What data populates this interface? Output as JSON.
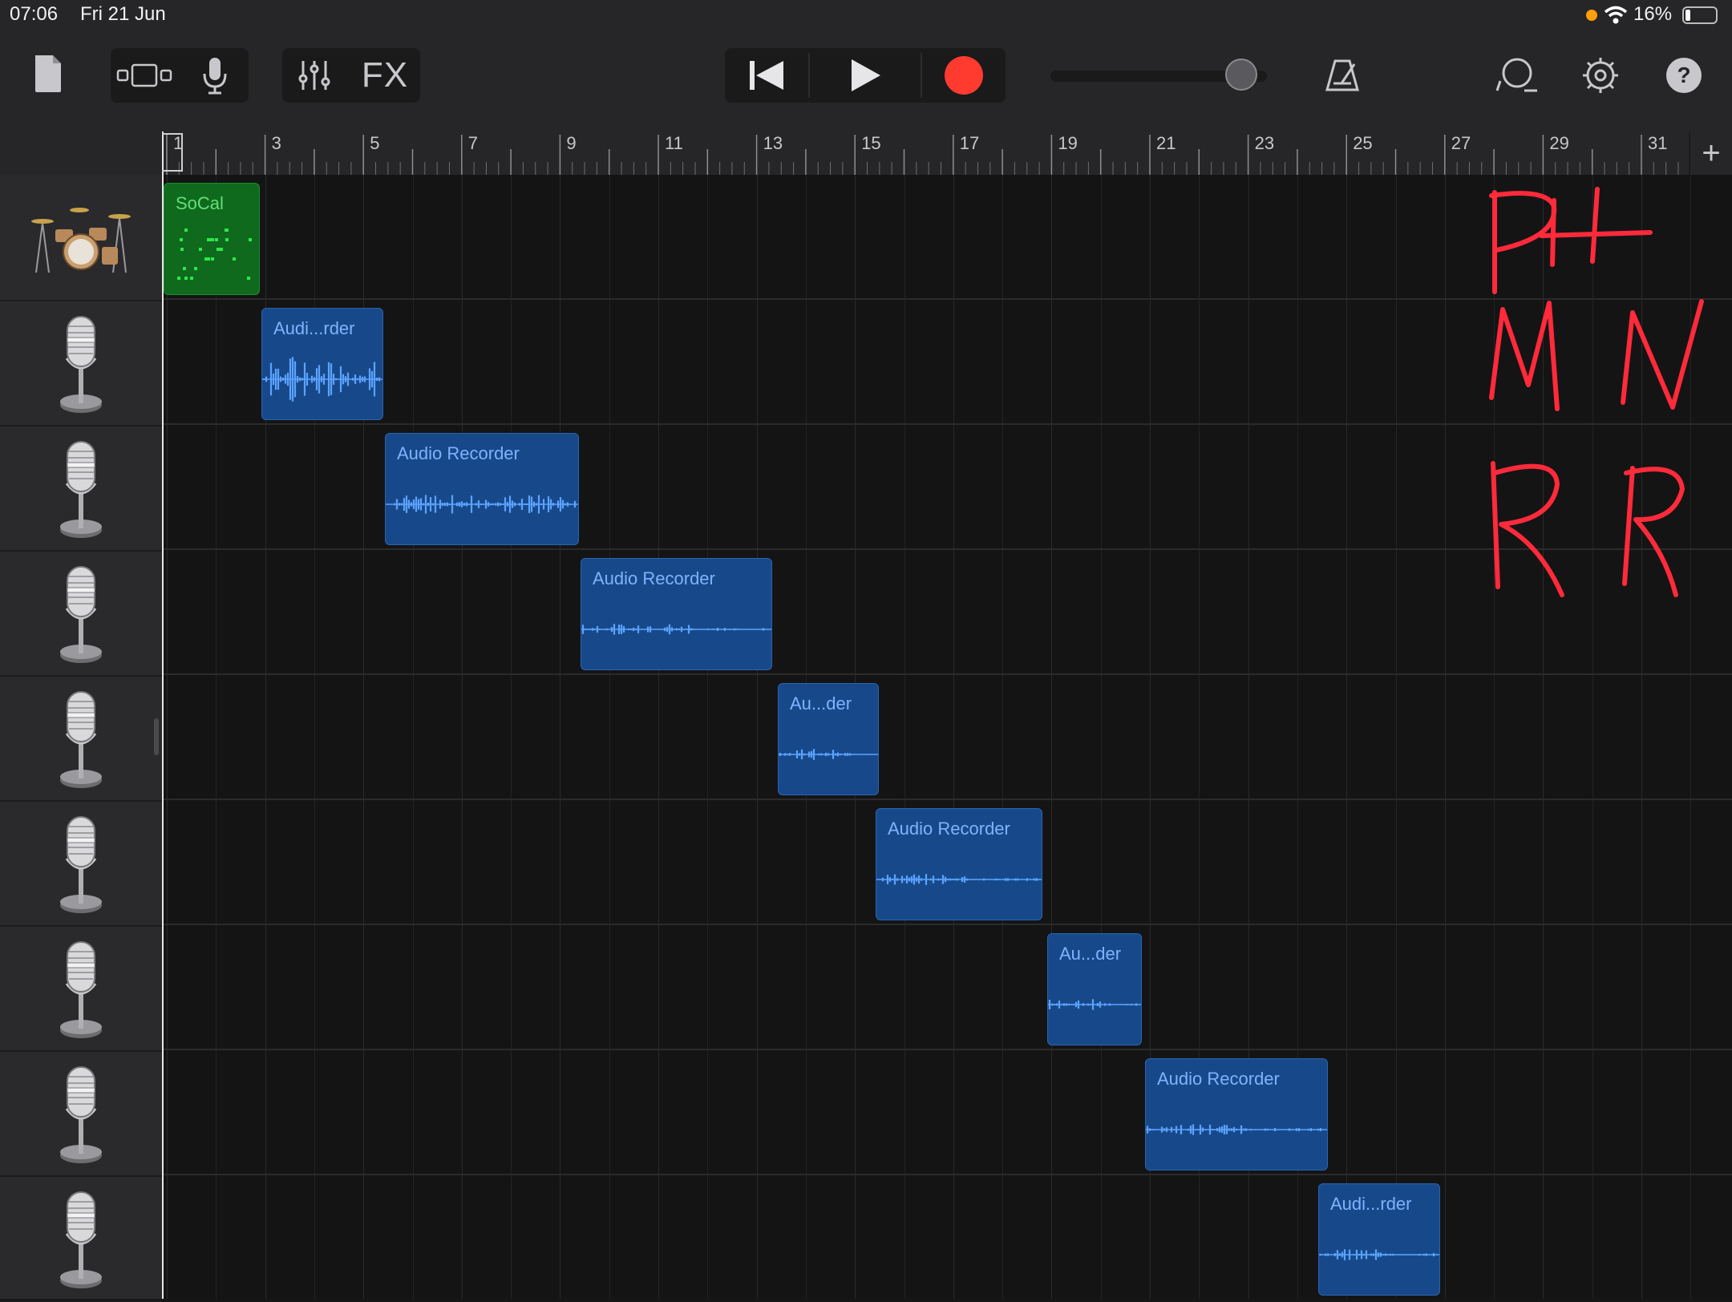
{
  "status_bar": {
    "time": "07:06",
    "date": "Fri 21 Jun",
    "battery": "16%",
    "icons": [
      "orange-dot-icon",
      "wifi-icon",
      "battery-icon"
    ]
  },
  "toolbar": {
    "left_icons": [
      "document-icon",
      "tracks-view-icon",
      "microphone-icon",
      "mixer-icon"
    ],
    "fx_label": "FX",
    "transport": [
      "go-to-start-icon",
      "play-icon",
      "record-icon"
    ],
    "volume_level": 0.88,
    "right_icons": [
      "metronome-icon",
      "loop-icon",
      "settings-icon",
      "help-icon"
    ]
  },
  "ruler": {
    "bar_numbers": [
      "1",
      "3",
      "5",
      "7",
      "9",
      "11",
      "13",
      "15",
      "17",
      "19",
      "21",
      "23",
      "25",
      "27",
      "29",
      "31"
    ],
    "add_label": "+"
  },
  "tracks": [
    {
      "instrument": "drum-kit-icon",
      "regions": [
        {
          "label": "SoCal",
          "type": "drummer"
        }
      ]
    },
    {
      "instrument": "microphone-icon",
      "regions": [
        {
          "label": "Audi...rder",
          "type": "audio"
        }
      ]
    },
    {
      "instrument": "microphone-icon",
      "regions": [
        {
          "label": "Audio Recorder",
          "type": "audio"
        }
      ]
    },
    {
      "instrument": "microphone-icon",
      "regions": [
        {
          "label": "Audio Recorder",
          "type": "audio"
        }
      ]
    },
    {
      "instrument": "microphone-icon",
      "regions": [
        {
          "label": "Au...der",
          "type": "audio"
        }
      ]
    },
    {
      "instrument": "microphone-icon",
      "regions": [
        {
          "label": "Audio Recorder",
          "type": "audio"
        }
      ]
    },
    {
      "instrument": "microphone-icon",
      "regions": [
        {
          "label": "Au...der",
          "type": "audio"
        }
      ]
    },
    {
      "instrument": "microphone-icon",
      "regions": [
        {
          "label": "Audio Recorder",
          "type": "audio"
        }
      ]
    },
    {
      "instrument": "microphone-icon",
      "regions": [
        {
          "label": "Audi...rder",
          "type": "audio"
        }
      ]
    }
  ],
  "colors": {
    "audio_region": "#17498a",
    "drummer_region": "#0f6a1d",
    "record": "#ff3b30",
    "annotation": "#ff2a3a"
  }
}
